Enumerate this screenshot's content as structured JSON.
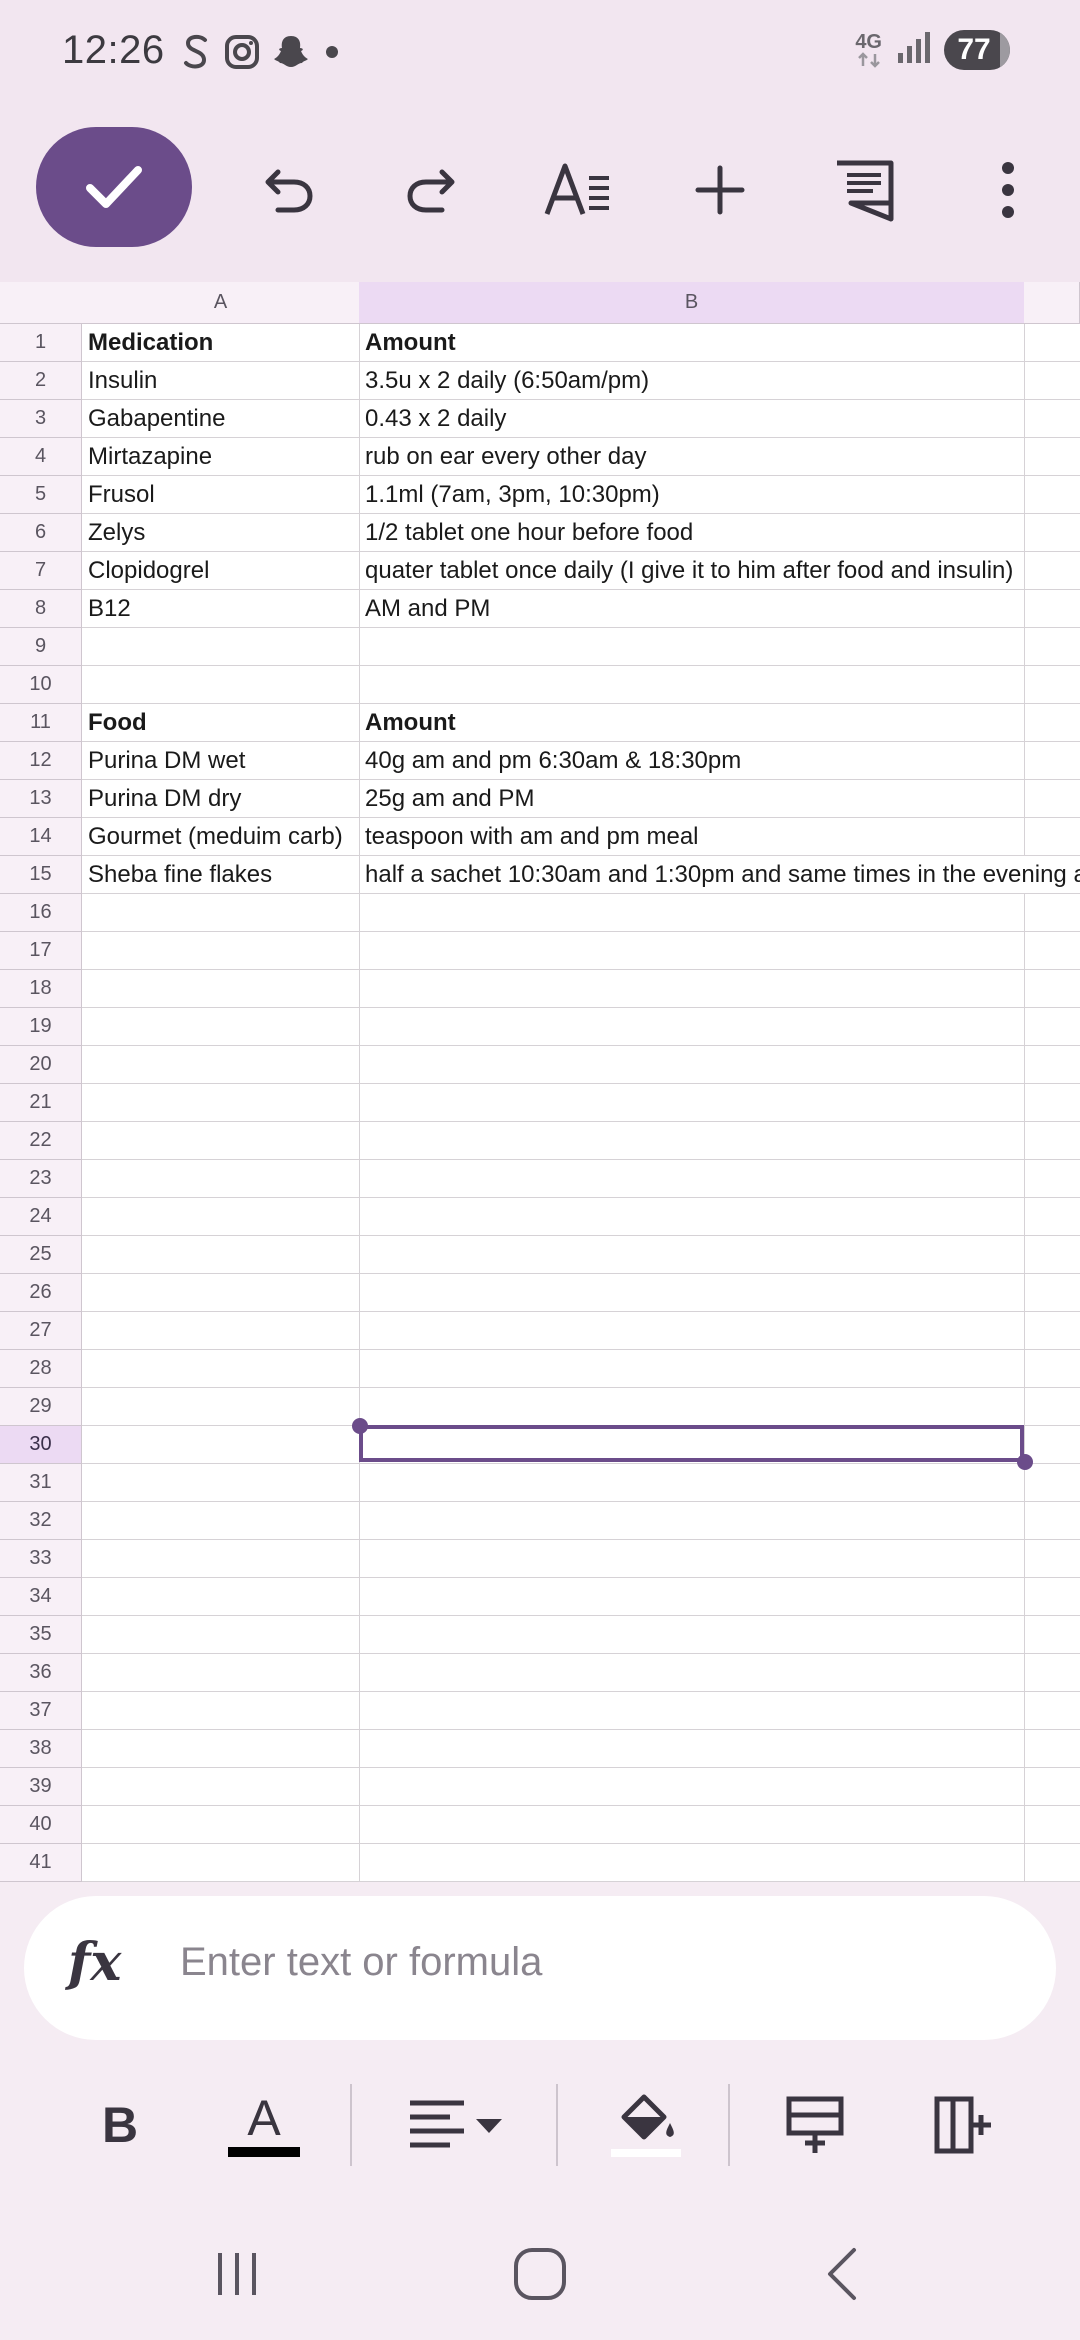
{
  "status_bar": {
    "time": "12:26",
    "network": "4G",
    "battery": "77",
    "icons": [
      "skype-icon",
      "instagram-icon",
      "snapchat-icon",
      "dot-icon",
      "signal-icon"
    ]
  },
  "toolbar": {
    "buttons": [
      "confirm-check-icon",
      "undo-icon",
      "redo-icon",
      "text-format-icon",
      "insert-plus-icon",
      "comment-icon",
      "more-vert-icon"
    ]
  },
  "sheet": {
    "columns": [
      "A",
      "B"
    ],
    "selected_column": "B",
    "selected_row": "30",
    "row_numbers": [
      "1",
      "2",
      "3",
      "4",
      "5",
      "6",
      "7",
      "8",
      "9",
      "10",
      "11",
      "12",
      "13",
      "14",
      "15",
      "16",
      "17",
      "18",
      "19",
      "20",
      "21",
      "22",
      "23",
      "24",
      "25",
      "26",
      "27",
      "28",
      "29",
      "30",
      "31",
      "32",
      "33",
      "34",
      "35",
      "36",
      "37",
      "38",
      "39",
      "40",
      "41"
    ],
    "rows": [
      {
        "a": "Medication",
        "b": "Amount",
        "bold": true
      },
      {
        "a": "Insulin",
        "b": "3.5u x 2 daily (6:50am/pm)"
      },
      {
        "a": "Gabapentine",
        "b": "0.43 x 2 daily"
      },
      {
        "a": "Mirtazapine",
        "b": "rub on ear every other day"
      },
      {
        "a": "Frusol",
        "b": "1.1ml (7am, 3pm, 10:30pm)"
      },
      {
        "a": "Zelys",
        "b": "1/2 tablet one hour before food"
      },
      {
        "a": "Clopidogrel",
        "b": "quater tablet once daily (I give it to him after food and insulin)"
      },
      {
        "a": "B12",
        "b": "AM and PM"
      },
      {
        "a": "",
        "b": ""
      },
      {
        "a": "",
        "b": ""
      },
      {
        "a": "Food",
        "b": "Amount",
        "bold": true
      },
      {
        "a": "Purina DM wet",
        "b": "40g am and pm 6:30am & 18:30pm"
      },
      {
        "a": "Purina DM dry",
        "b": "25g am and PM"
      },
      {
        "a": "Gourmet (meduim carb)",
        "b": "teaspoon with am and pm meal"
      },
      {
        "a": "Sheba fine flakes",
        "b": "half a sachet 10:30am and 1:30pm and same times in the evening a"
      }
    ]
  },
  "formula_bar": {
    "icon": "fx",
    "placeholder": "Enter text or formula"
  },
  "format_bar": {
    "bold_label": "B",
    "text_color_label": "A",
    "text_color": "#000000",
    "buttons": [
      "bold-icon",
      "text-color-icon",
      "align-icon",
      "fill-color-icon",
      "insert-row-icon",
      "insert-column-icon"
    ]
  },
  "colors": {
    "accent": "#6b4c8a",
    "header_bg": "#f8f0f7",
    "selected_header_bg": "#ecdaf3"
  }
}
